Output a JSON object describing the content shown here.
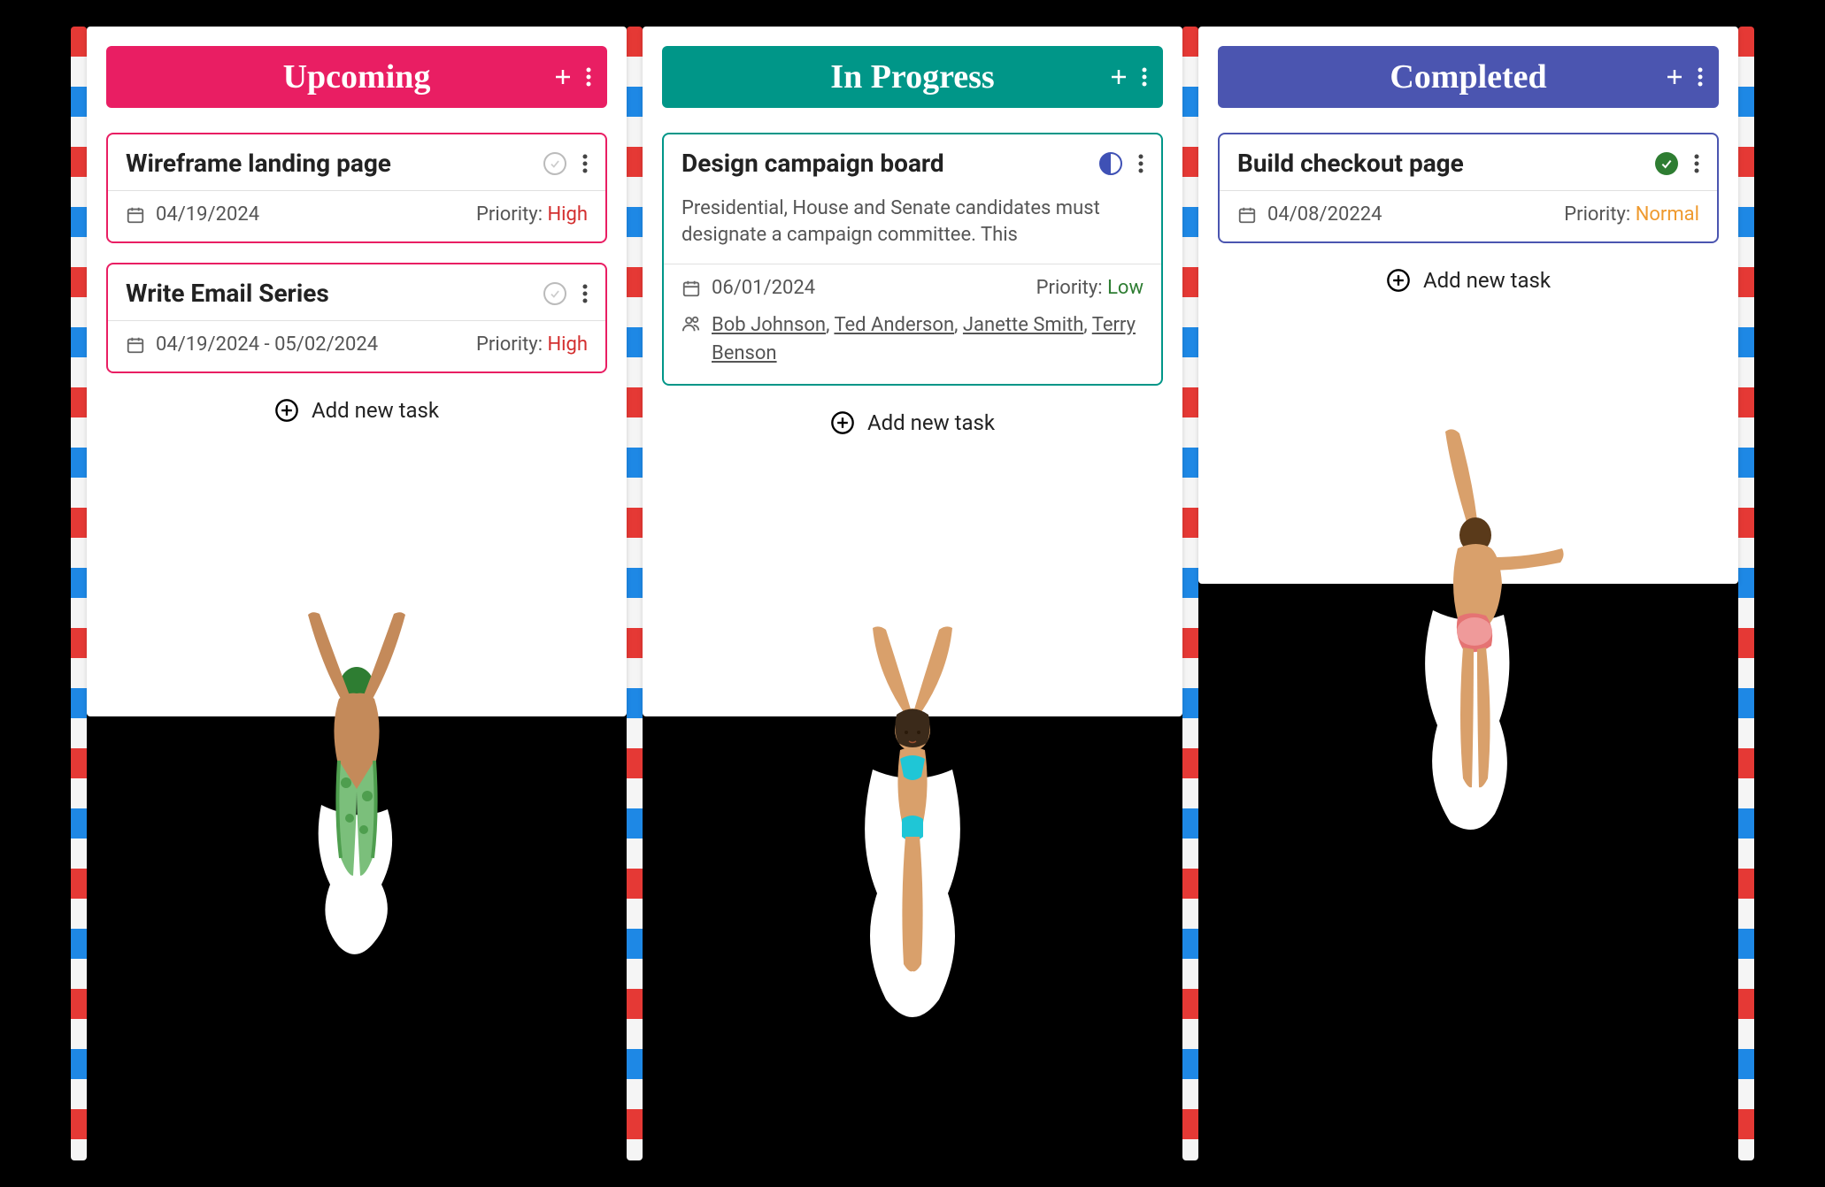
{
  "columns": {
    "upcoming": {
      "title": "Upcoming",
      "add_label": "Add new task",
      "cards": [
        {
          "title": "Wireframe landing page",
          "date": "04/19/2024",
          "priority_label": "Priority: ",
          "priority_value": "High",
          "priority_class": "prio-high",
          "status": "empty"
        },
        {
          "title": "Write Email Series",
          "date": "04/19/2024 - 05/02/2024",
          "priority_label": "Priority: ",
          "priority_value": "High",
          "priority_class": "prio-high",
          "status": "empty"
        }
      ]
    },
    "inprogress": {
      "title": "In Progress",
      "add_label": "Add new task",
      "cards": [
        {
          "title": "Design campaign board",
          "body": "Presidential, House and Senate candidates must designate a campaign committee. This",
          "date": "06/01/2024",
          "priority_label": "Priority: ",
          "priority_value": "Low",
          "priority_class": "prio-low",
          "status": "half",
          "people": [
            "Bob Johnson",
            "Ted Anderson",
            "Janette Smith",
            "Terry Benson"
          ]
        }
      ]
    },
    "completed": {
      "title": "Completed",
      "add_label": "Add new task",
      "cards": [
        {
          "title": "Build checkout page",
          "date": "04/08/20224",
          "priority_label": "Priority: ",
          "priority_value": "Normal",
          "priority_class": "prio-normal",
          "status": "done"
        }
      ]
    }
  }
}
